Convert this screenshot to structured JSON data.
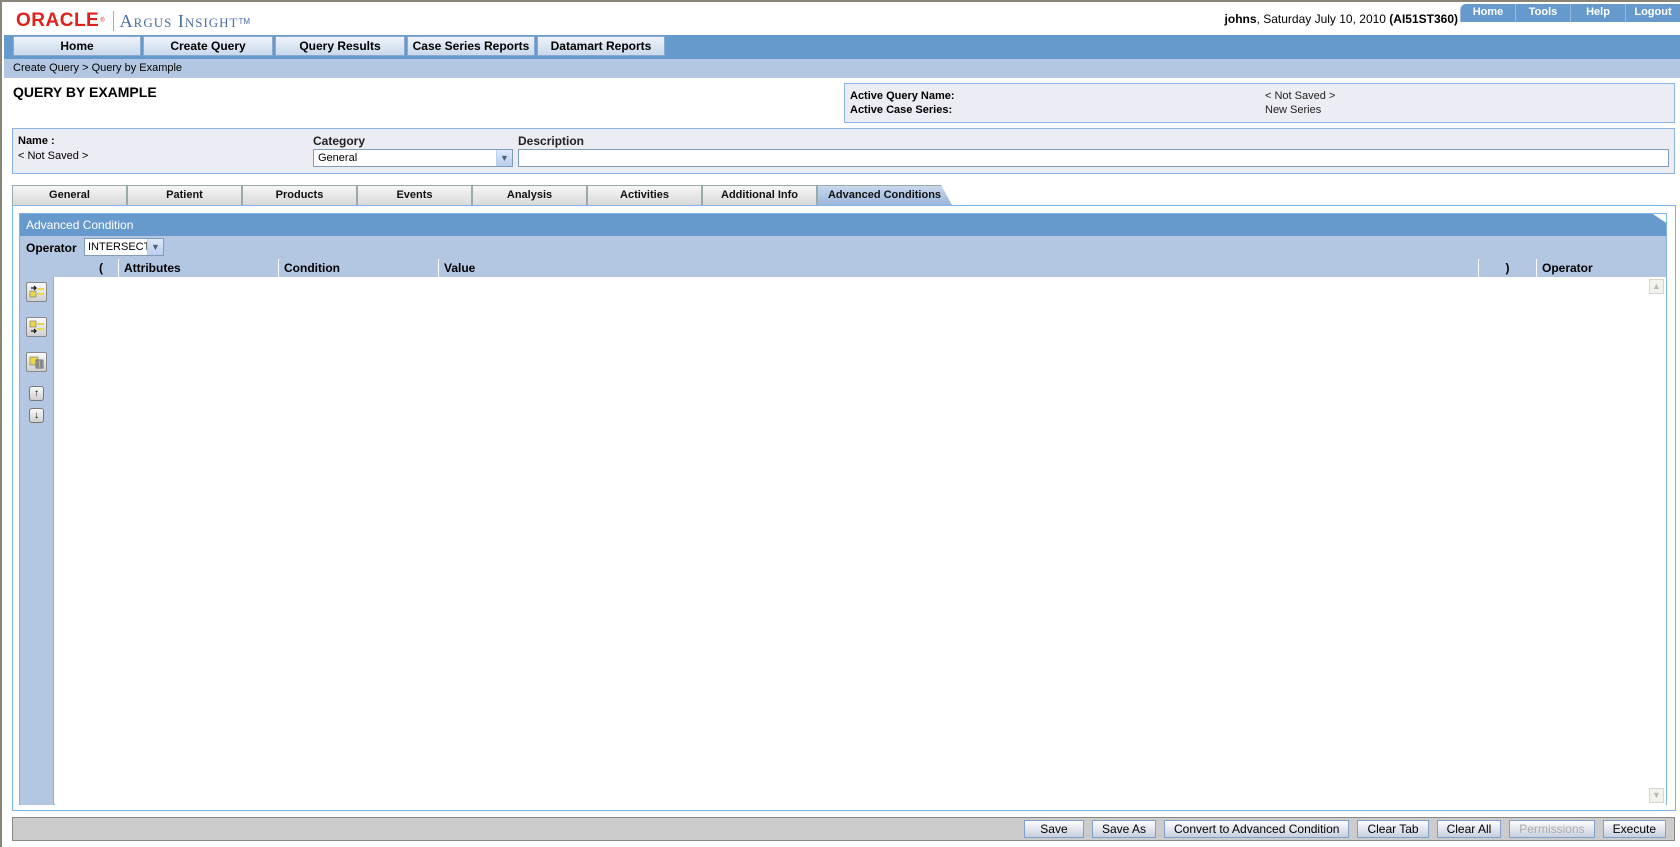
{
  "header": {
    "brand": "ORACLE",
    "product": "Argus Insight",
    "user": "johns",
    "date_text": ", Saturday July 10, 2010 ",
    "server": "(AI51ST360)",
    "top_links": [
      "Home",
      "Tools",
      "Help",
      "Logout"
    ]
  },
  "nav": {
    "items": [
      "Home",
      "Create Query",
      "Query Results",
      "Case Series Reports",
      "Datamart Reports"
    ]
  },
  "breadcrumb": "Create Query  >  Query by Example",
  "page_title": "QUERY BY EXAMPLE",
  "active_info": {
    "query_name_label": "Active Query Name:",
    "query_name_value": "< Not Saved >",
    "case_series_label": "Active Case Series:",
    "case_series_value": "New Series"
  },
  "query_form": {
    "name_label": "Name :",
    "name_value": "< Not Saved >",
    "category_label": "Category",
    "category_value": "General",
    "description_label": "Description",
    "description_value": ""
  },
  "tabs": [
    "General",
    "Patient",
    "Products",
    "Events",
    "Analysis",
    "Activities",
    "Additional Info",
    "Advanced Conditions"
  ],
  "active_tab": "Advanced Conditions",
  "advanced": {
    "title": "Advanced Condition",
    "operator_label": "Operator",
    "operator_value": "INTERSECT",
    "columns": [
      "(",
      "Attributes",
      "Condition",
      "Value",
      ")",
      "Operator"
    ]
  },
  "footer_buttons": [
    "Save",
    "Save As",
    "Convert to Advanced Condition",
    "Clear Tab",
    "Clear All",
    "Permissions",
    "Execute"
  ]
}
